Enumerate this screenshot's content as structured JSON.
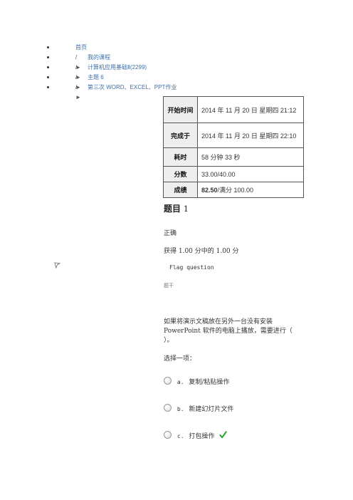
{
  "breadcrumb": {
    "separator": "/ ►",
    "items": [
      {
        "label": "首页"
      },
      {
        "label": "我的课程"
      },
      {
        "label": "计算机应用基础Ⅱ(2299)"
      },
      {
        "label": "主题 6"
      },
      {
        "label": "第三次 WORD、EXCEL、PPT作业"
      }
    ]
  },
  "summary": {
    "rows": [
      {
        "key": "开始时间",
        "value": "2014 年 11 月 20 日  星期四 21:12"
      },
      {
        "key": "完成于",
        "value": "2014 年 11 月 20 日  星期四 22:10"
      },
      {
        "key": "耗时",
        "value": "58  分钟  33  秒"
      },
      {
        "key": "分数",
        "value": "33.00/40.00"
      }
    ],
    "grade_key": "成绩",
    "grade_bold": "82.50",
    "grade_rest": "/满分 100.00"
  },
  "question": {
    "title": "题目",
    "number": "1",
    "status": "正确",
    "grade": "获得 1.00 分中的 1.00 分",
    "flag_label": "Flag question",
    "stem_label": "题干",
    "text": "如果将演示文稿放在另外一台没有安装PowerPoint 软件的电脑上播放，需要进行（   ）。",
    "prompt": "选择一项：",
    "options": [
      {
        "letter": "a.",
        "text": "复制/粘贴操作",
        "correct": false
      },
      {
        "letter": "b.",
        "text": "新建幻灯片文件",
        "correct": false
      },
      {
        "letter": "c.",
        "text": "打包操作",
        "correct": true
      }
    ]
  },
  "colors": {
    "link": "#3d6fa8",
    "tick": "#2ea52e"
  }
}
